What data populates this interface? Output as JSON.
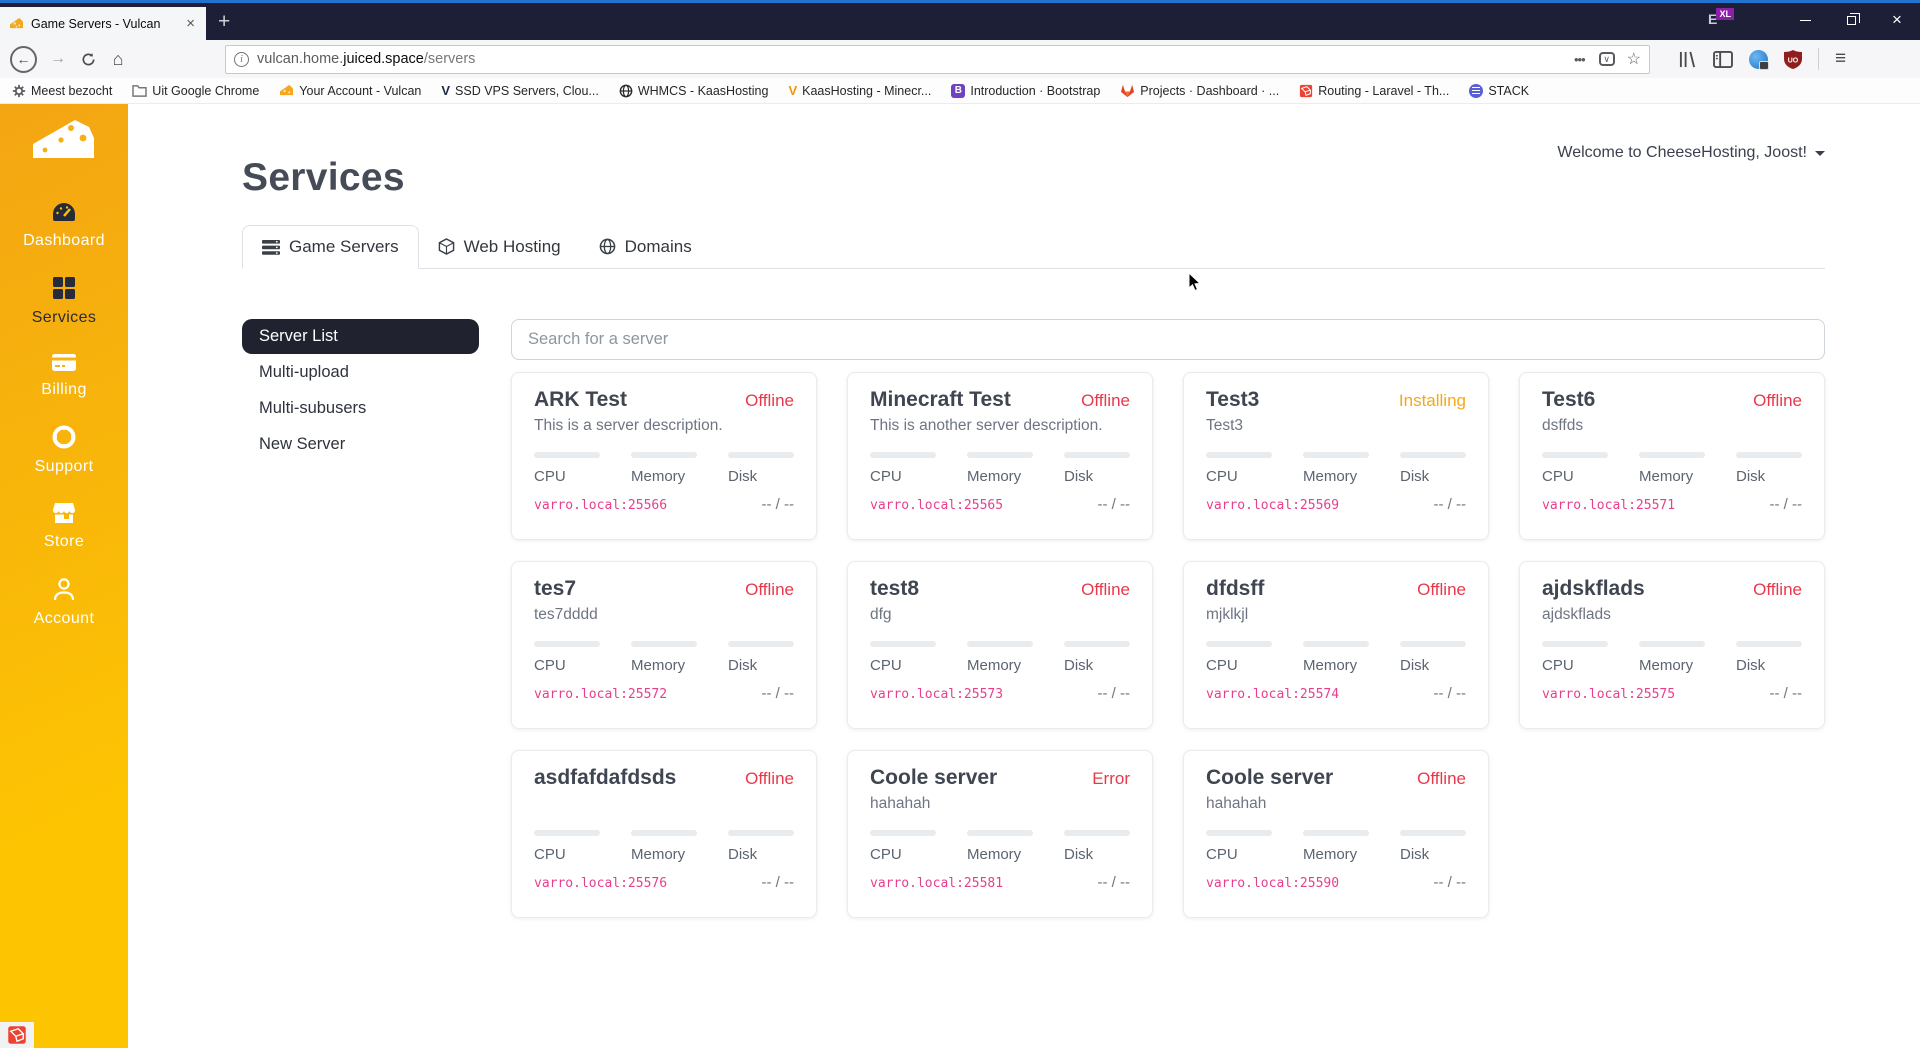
{
  "browser": {
    "tab_title": "Game Servers - Vulcan",
    "url": {
      "prefix": "vulcan.home.",
      "domain": "juiced.space",
      "path": "/servers"
    },
    "bookmarks": [
      {
        "label": "Meest bezocht",
        "icon": "gear-icon"
      },
      {
        "label": "Uit Google Chrome",
        "icon": "folder-icon"
      },
      {
        "label": "Your Account - Vulcan",
        "icon": "cheese-icon"
      },
      {
        "label": "SSD VPS Servers, Clou...",
        "icon": "vultr-icon"
      },
      {
        "label": "WHMCS - KaasHosting",
        "icon": "globe-icon"
      },
      {
        "label": "KaasHosting - Minecr...",
        "icon": "kaas-icon"
      },
      {
        "label": "Introduction · Bootstrap",
        "icon": "bootstrap-icon"
      },
      {
        "label": "Projects · Dashboard · ...",
        "icon": "gitlab-icon"
      },
      {
        "label": "Routing - Laravel - Th...",
        "icon": "laravel-icon"
      },
      {
        "label": "STACK",
        "icon": "stack-icon"
      }
    ]
  },
  "icons": {
    "close": "×",
    "new_tab": "+",
    "back": "←",
    "forward": "→",
    "home": "⌂",
    "more": "•••",
    "pocket_check": "∨",
    "star": "☆",
    "menu": "≡",
    "info": "i"
  },
  "sidebar": {
    "items": [
      {
        "label": "Dashboard"
      },
      {
        "label": "Services"
      },
      {
        "label": "Billing"
      },
      {
        "label": "Support"
      },
      {
        "label": "Store"
      },
      {
        "label": "Account"
      }
    ]
  },
  "page": {
    "welcome": "Welcome to CheeseHosting, Joost!",
    "title": "Services"
  },
  "tabs": [
    {
      "label": "Game Servers"
    },
    {
      "label": "Web Hosting"
    },
    {
      "label": "Domains"
    }
  ],
  "menu": {
    "items": [
      "Server List",
      "Multi-upload",
      "Multi-subusers",
      "New Server"
    ]
  },
  "search": {
    "placeholder": "Search for a server"
  },
  "cards": {
    "stat_labels": [
      "CPU",
      "Memory",
      "Disk"
    ],
    "players": "-- / --"
  },
  "status_colors": {
    "Offline": "#e8394a",
    "Installing": "#f4a81b",
    "Error": "#e8394a"
  },
  "servers": [
    {
      "name": "ARK Test",
      "status": "Offline",
      "description": "This is a server description.",
      "address": "varro.local:25566"
    },
    {
      "name": "Minecraft Test",
      "status": "Offline",
      "description": "This is another server description.",
      "address": "varro.local:25565"
    },
    {
      "name": "Test3",
      "status": "Installing",
      "description": "Test3",
      "address": "varro.local:25569"
    },
    {
      "name": "Test6",
      "status": "Offline",
      "description": "dsffds",
      "address": "varro.local:25571"
    },
    {
      "name": "tes7",
      "status": "Offline",
      "description": "tes7dddd",
      "address": "varro.local:25572"
    },
    {
      "name": "test8",
      "status": "Offline",
      "description": "dfg",
      "address": "varro.local:25573"
    },
    {
      "name": "dfdsff",
      "status": "Offline",
      "description": "mjklkjl",
      "address": "varro.local:25574"
    },
    {
      "name": "ajdskflads",
      "status": "Offline",
      "description": "ajdskflads",
      "address": "varro.local:25575"
    },
    {
      "name": "asdfafdafdsds",
      "status": "Offline",
      "description": "",
      "address": "varro.local:25576"
    },
    {
      "name": "Coole server",
      "status": "Error",
      "description": "hahahah",
      "address": "varro.local:25581"
    },
    {
      "name": "Coole server",
      "status": "Offline",
      "description": "hahahah",
      "address": "varro.local:25590"
    }
  ]
}
